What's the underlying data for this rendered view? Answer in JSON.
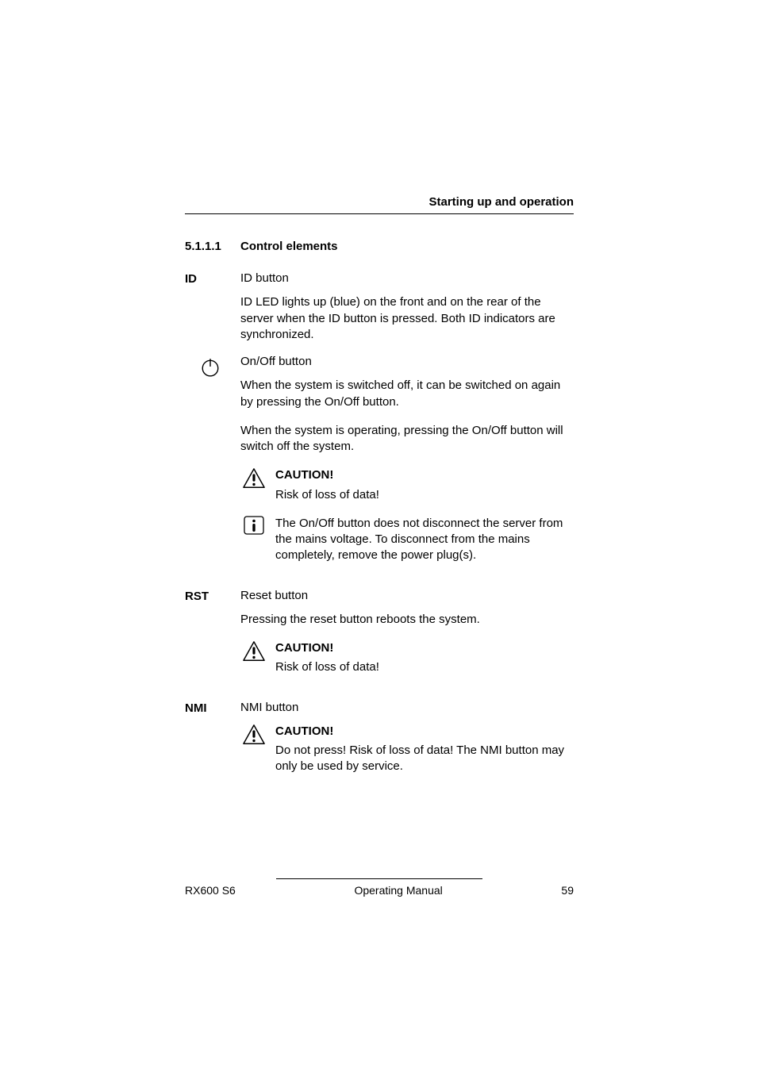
{
  "header": {
    "running_title": "Starting up and operation"
  },
  "section": {
    "number": "5.1.1.1",
    "title": "Control elements"
  },
  "items": {
    "id": {
      "label": "ID",
      "title": "ID button",
      "desc": "ID LED lights up (blue) on the front and on the rear of the server when the ID button is pressed. Both ID indicators are synchronized."
    },
    "onoff": {
      "title": "On/Off button",
      "p1": "When the system is switched off, it can be switched on again by pressing the On/Off button.",
      "p2": "When the system is operating, pressing the On/Off button will switch off the system.",
      "caution_head": "CAUTION!",
      "caution_body": "Risk of loss of data!",
      "info_body": "The On/Off button does not disconnect the server from the mains voltage. To disconnect from the mains completely, remove the power plug(s)."
    },
    "rst": {
      "label": "RST",
      "title": "Reset button",
      "desc": "Pressing the reset button reboots the system.",
      "caution_head": "CAUTION!",
      "caution_body": "Risk of loss of data!"
    },
    "nmi": {
      "label": "NMI",
      "title": "NMI button",
      "caution_head": "CAUTION!",
      "caution_body": "Do not press! Risk of loss of data! The NMI button may only be used by service."
    }
  },
  "footer": {
    "left": "RX600 S6",
    "middle": "Operating Manual",
    "right": "59"
  }
}
